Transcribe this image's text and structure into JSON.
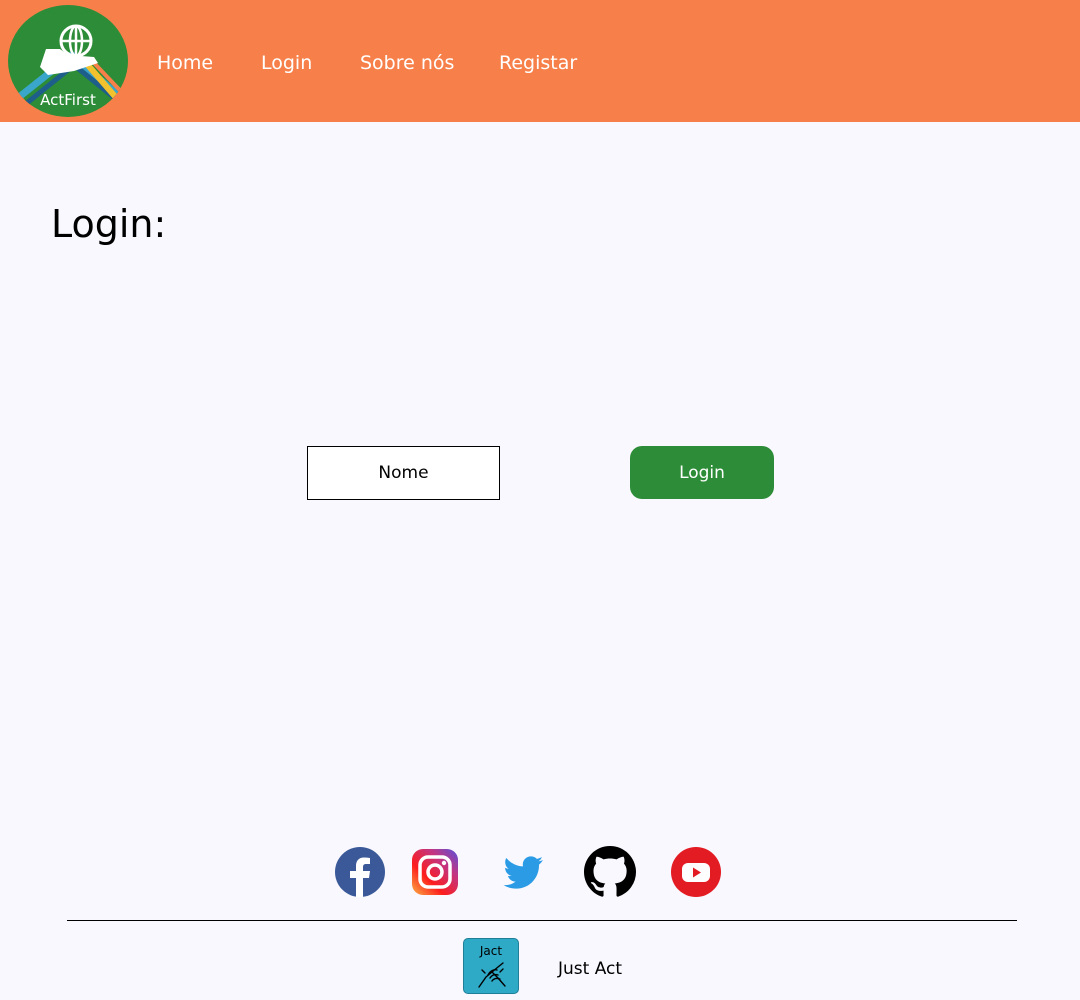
{
  "brand": {
    "logo_text": "ActFirst",
    "colors": {
      "navbar": "#f7804a",
      "logo_green": "#2d8c37",
      "button_green": "#2d8c37",
      "background": "#f9f8fe"
    }
  },
  "nav": {
    "items": [
      {
        "label": "Home"
      },
      {
        "label": "Login"
      },
      {
        "label": "Sobre nós"
      },
      {
        "label": "Registar"
      }
    ]
  },
  "main": {
    "title": "Login:",
    "name_input": {
      "placeholder": "Nome",
      "value": ""
    },
    "login_button": "Login"
  },
  "footer": {
    "social_icons": [
      "facebook-icon",
      "instagram-icon",
      "twitter-icon",
      "github-icon",
      "youtube-icon"
    ],
    "badge_label": "Jact",
    "brand_name": "Just Act"
  }
}
